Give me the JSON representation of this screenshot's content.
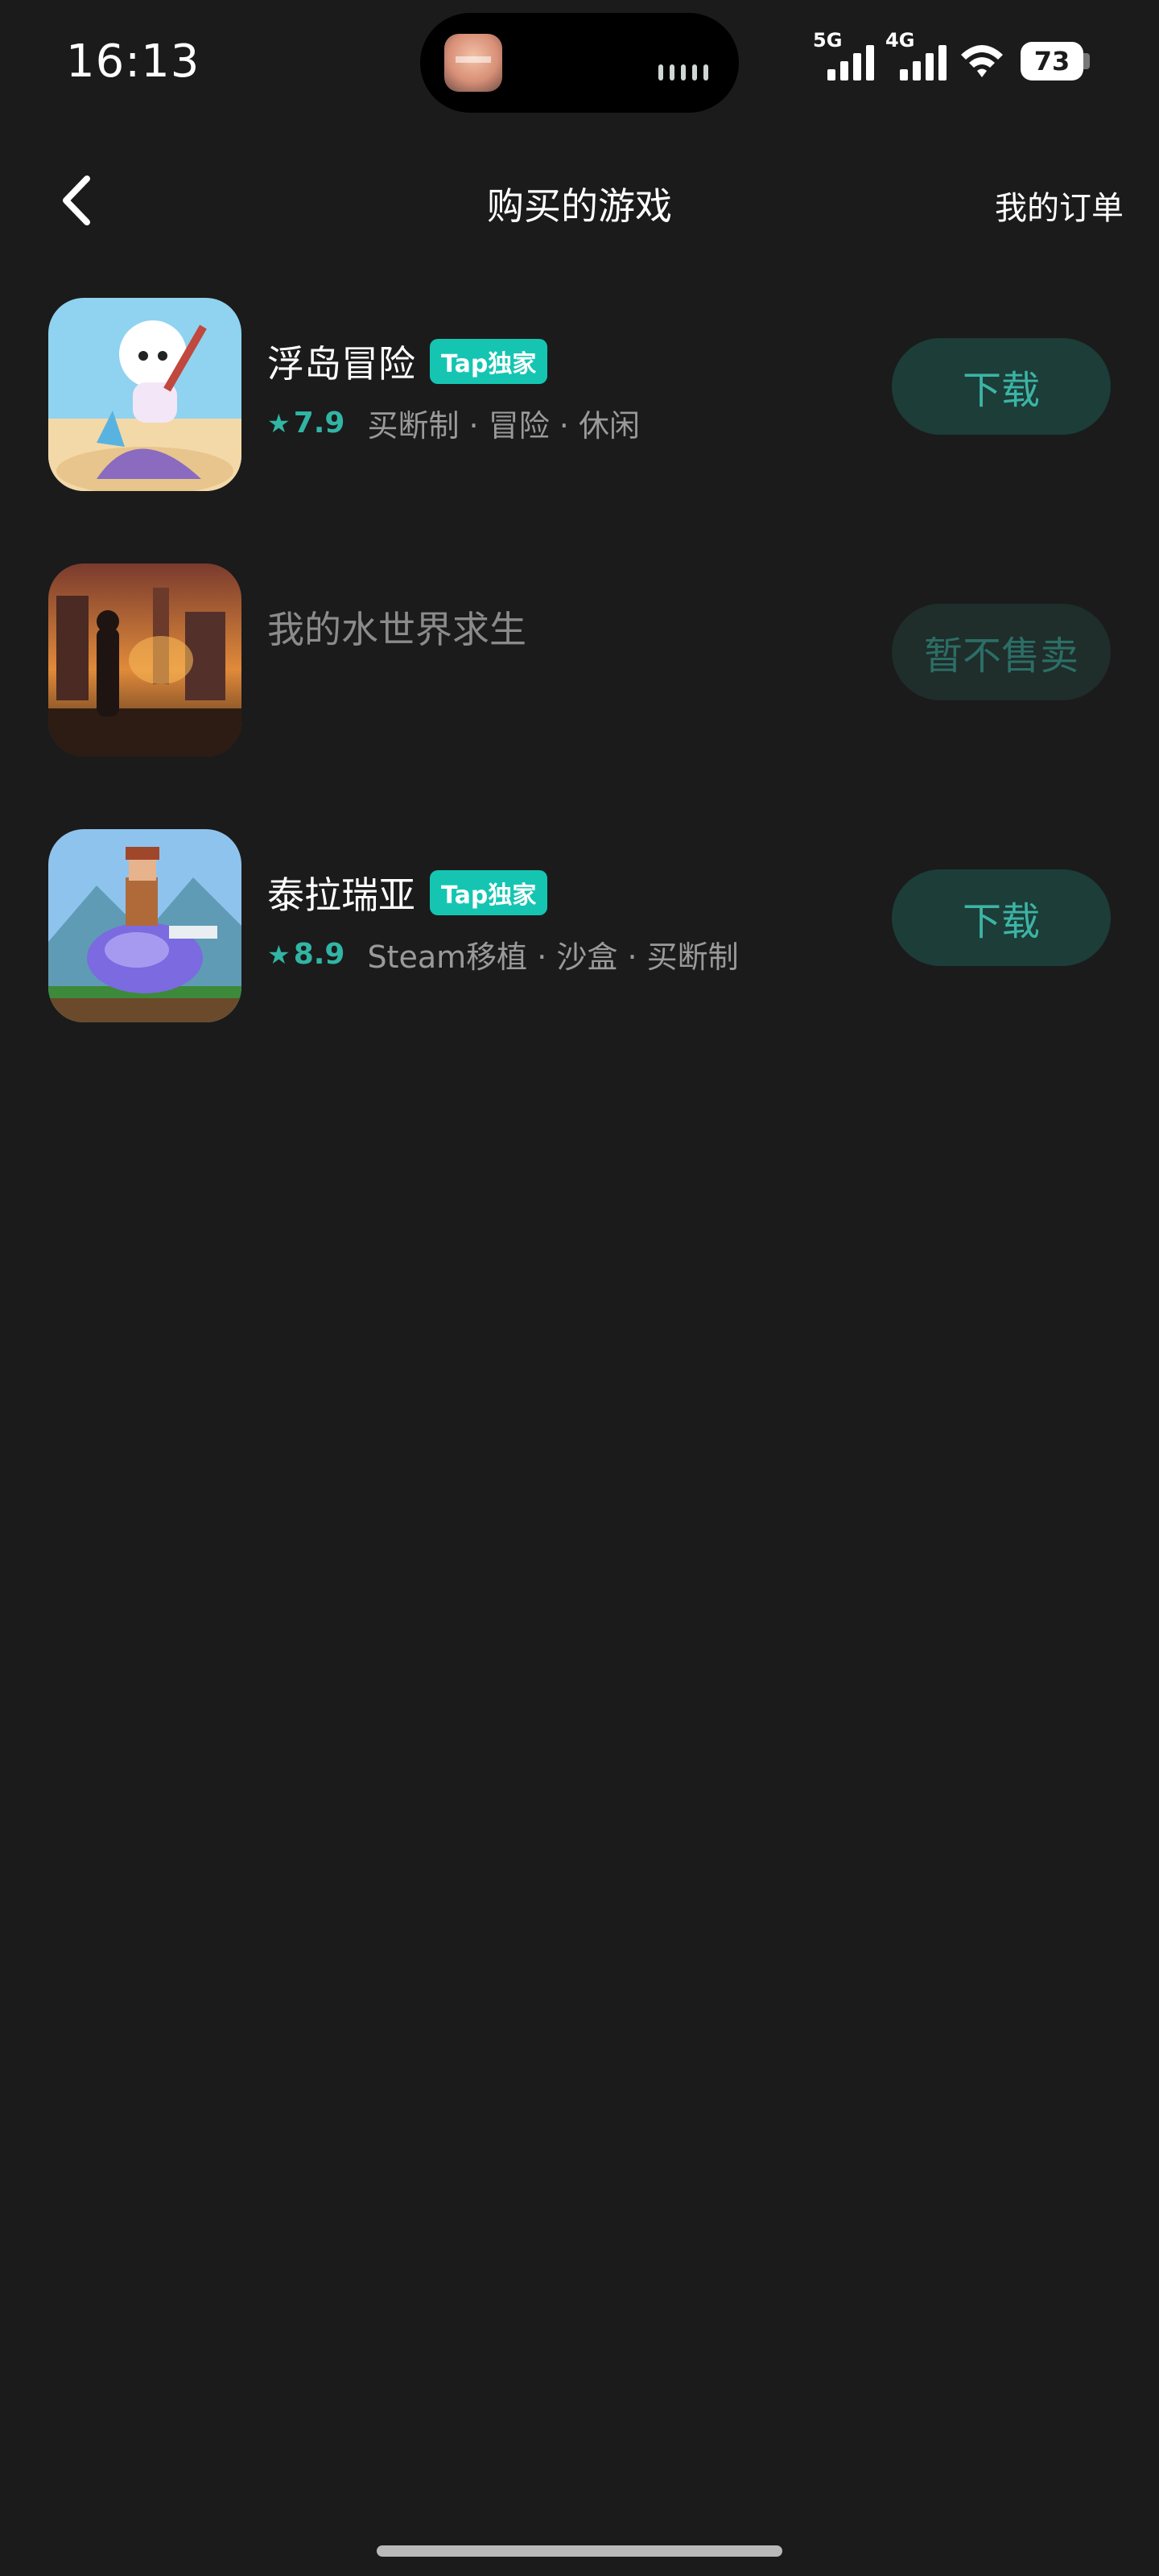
{
  "status_bar": {
    "time": "16:13",
    "signal_1_label": "5G",
    "signal_2_label": "4G",
    "battery": "73"
  },
  "header": {
    "title": "购买的游戏",
    "orders_link": "我的订单"
  },
  "games": [
    {
      "name": "浮岛冒险",
      "badge": "Tap独家",
      "rating": "7.9",
      "tags": "买断制 · 冒险 · 休闲",
      "action": "下载",
      "status": "downloadable"
    },
    {
      "name": "我的水世界求生",
      "action": "暂不售卖",
      "status": "unavailable"
    },
    {
      "name": "泰拉瑞亚",
      "badge": "Tap独家",
      "rating": "8.9",
      "tags": "Steam移植 · 沙盒 · 买断制",
      "action": "下载",
      "status": "downloadable"
    }
  ],
  "colors": {
    "background": "#1b1b1b",
    "accent": "#31b5a5",
    "badge": "#15c5b2",
    "button_bg": "#1c3d38"
  }
}
